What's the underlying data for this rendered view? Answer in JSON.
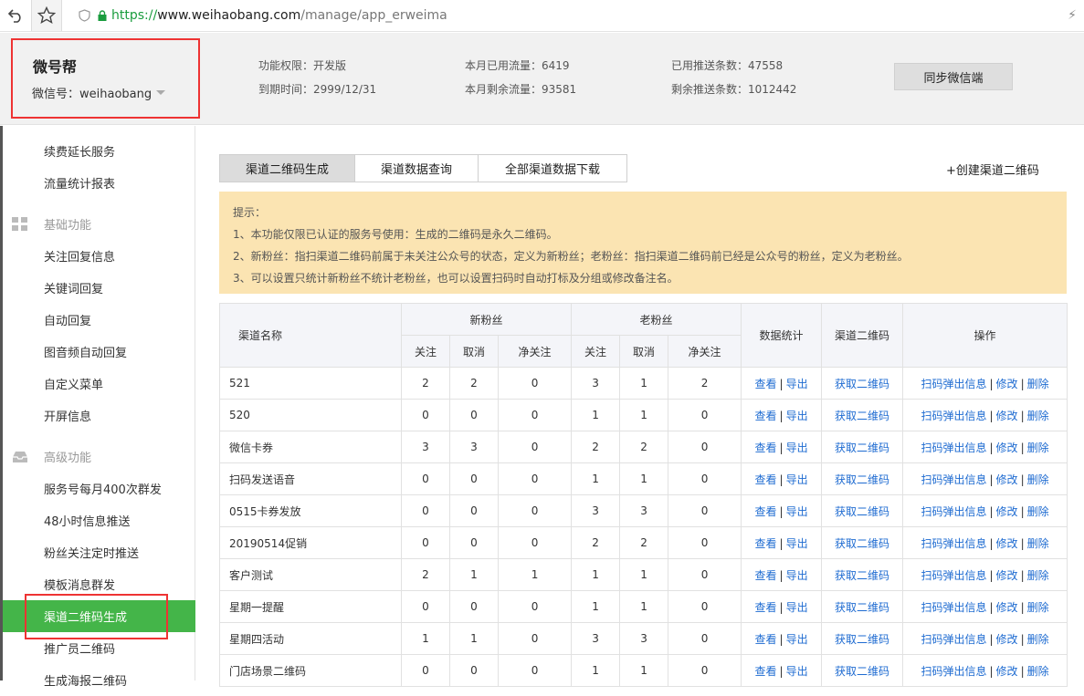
{
  "browser": {
    "url_scheme": "https://",
    "url_host": "www.weihaobang.com",
    "url_path": "/manage/app_erweima",
    "bolt": "⚡"
  },
  "header": {
    "brand_name": "微号帮",
    "wechat_id": "微信号：weihaobang",
    "permission": "功能权限：开发版",
    "expire": "到期时间：2999/12/31",
    "traffic_used": "本月已用流量：6419",
    "traffic_left": "本月剩余流量：93581",
    "push_used": "已用推送条数：47558",
    "push_left": "剩余推送条数：1012442",
    "sync_button": "同步微信端"
  },
  "sidebar": {
    "items": [
      {
        "label": "续费延长服务",
        "type": "item"
      },
      {
        "label": "流量统计报表",
        "type": "item"
      },
      {
        "label": "基础功能",
        "type": "group"
      },
      {
        "label": "关注回复信息",
        "type": "item"
      },
      {
        "label": "关键词回复",
        "type": "item"
      },
      {
        "label": "自动回复",
        "type": "item"
      },
      {
        "label": "图音频自动回复",
        "type": "item"
      },
      {
        "label": "自定义菜单",
        "type": "item"
      },
      {
        "label": "开屏信息",
        "type": "item"
      },
      {
        "label": "高级功能",
        "type": "group"
      },
      {
        "label": "服务号每月400次群发",
        "type": "item"
      },
      {
        "label": "48小时信息推送",
        "type": "item"
      },
      {
        "label": "粉丝关注定时推送",
        "type": "item"
      },
      {
        "label": "模板消息群发",
        "type": "item"
      },
      {
        "label": "渠道二维码生成",
        "type": "item",
        "active": true
      },
      {
        "label": "推广员二维码",
        "type": "item"
      },
      {
        "label": "生成海报二维码",
        "type": "item"
      }
    ]
  },
  "main": {
    "tabs": [
      "渠道二维码生成",
      "渠道数据查询",
      "全部渠道数据下载"
    ],
    "create_link": "+创建渠道二维码",
    "notice": {
      "title": "提示：",
      "lines": [
        "1、本功能仅限已认证的服务号使用：生成的二维码是永久二维码。",
        "2、新粉丝：指扫渠道二维码前属于未关注公众号的状态，定义为新粉丝；老粉丝：指扫渠道二维码前已经是公众号的粉丝，定义为老粉丝。",
        "3、可以设置只统计新粉丝不统计老粉丝，也可以设置扫码时自动打标及分组或修改备注名。"
      ]
    },
    "table": {
      "headers": {
        "name": "渠道名称",
        "new_fans": "新粉丝",
        "old_fans": "老粉丝",
        "follow": "关注",
        "cancel": "取消",
        "net": "净关注",
        "stats": "数据统计",
        "qrcode": "渠道二维码",
        "ops": "操作"
      },
      "links": {
        "view": "查看",
        "export": "导出",
        "get_qr": "获取二维码",
        "popup": "扫码弹出信息",
        "edit": "修改",
        "delete": "删除",
        "sep": "|"
      },
      "rows": [
        {
          "name": "521",
          "n": [
            "2",
            "2",
            "0"
          ],
          "o": [
            "3",
            "1",
            "2"
          ]
        },
        {
          "name": "520",
          "n": [
            "0",
            "0",
            "0"
          ],
          "o": [
            "1",
            "1",
            "0"
          ]
        },
        {
          "name": "微信卡券",
          "n": [
            "3",
            "3",
            "0"
          ],
          "o": [
            "2",
            "2",
            "0"
          ]
        },
        {
          "name": "扫码发送语音",
          "n": [
            "0",
            "0",
            "0"
          ],
          "o": [
            "1",
            "1",
            "0"
          ]
        },
        {
          "name": "0515卡券发放",
          "n": [
            "0",
            "0",
            "0"
          ],
          "o": [
            "3",
            "3",
            "0"
          ]
        },
        {
          "name": "20190514促销",
          "n": [
            "0",
            "0",
            "0"
          ],
          "o": [
            "2",
            "2",
            "0"
          ]
        },
        {
          "name": "客户测试",
          "n": [
            "2",
            "1",
            "1"
          ],
          "o": [
            "1",
            "1",
            "0"
          ]
        },
        {
          "name": "星期一提醒",
          "n": [
            "0",
            "0",
            "0"
          ],
          "o": [
            "1",
            "1",
            "0"
          ]
        },
        {
          "name": "星期四活动",
          "n": [
            "1",
            "1",
            "0"
          ],
          "o": [
            "3",
            "3",
            "0"
          ]
        },
        {
          "name": "门店场景二维码",
          "n": [
            "0",
            "0",
            "0"
          ],
          "o": [
            "1",
            "1",
            "0"
          ]
        }
      ]
    }
  }
}
